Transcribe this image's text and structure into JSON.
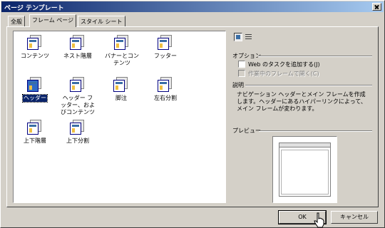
{
  "window": {
    "title": "ページ テンプレート"
  },
  "tabs": [
    {
      "label": "全般",
      "active": false
    },
    {
      "label": "フレーム ページ",
      "active": true
    },
    {
      "label": "スタイル シート",
      "active": false
    }
  ],
  "templates": [
    {
      "label": "コンテンツ",
      "selected": false
    },
    {
      "label": "ネスト階層",
      "selected": false
    },
    {
      "label": "バナーとコンテンツ",
      "selected": false
    },
    {
      "label": "フッター",
      "selected": false
    },
    {
      "label": "ヘッダー",
      "selected": true
    },
    {
      "label": "ヘッダー フッター、およびコンテンツ",
      "selected": false
    },
    {
      "label": "脚注",
      "selected": false
    },
    {
      "label": "左右分割",
      "selected": false
    },
    {
      "label": "上下階層",
      "selected": false
    },
    {
      "label": "上下分割",
      "selected": false
    }
  ],
  "view_icons": [
    "large-icons-view-icon",
    "list-view-icon"
  ],
  "options": {
    "heading": "オプション",
    "add_web_task": {
      "label": "Web のタスクを追加する(J)",
      "checked": false,
      "enabled": true
    },
    "open_in_current_frame": {
      "label": "作業中のフレームで開く(C)",
      "checked": false,
      "enabled": false
    }
  },
  "description": {
    "heading": "説明",
    "lines": [
      "ナビゲーション ヘッダーとメイン フレームを作成",
      "します。ヘッダーにあるハイパーリンクによって、",
      "メイン フレームが変わります。"
    ]
  },
  "preview": {
    "heading": "プレビュー"
  },
  "buttons": {
    "ok": "OK",
    "cancel": "キャンセル"
  },
  "colors": {
    "titlebar_start": "#0a246a",
    "titlebar_end": "#a6caf0",
    "face": "#d4d0c8",
    "selection": "#0a246a"
  }
}
